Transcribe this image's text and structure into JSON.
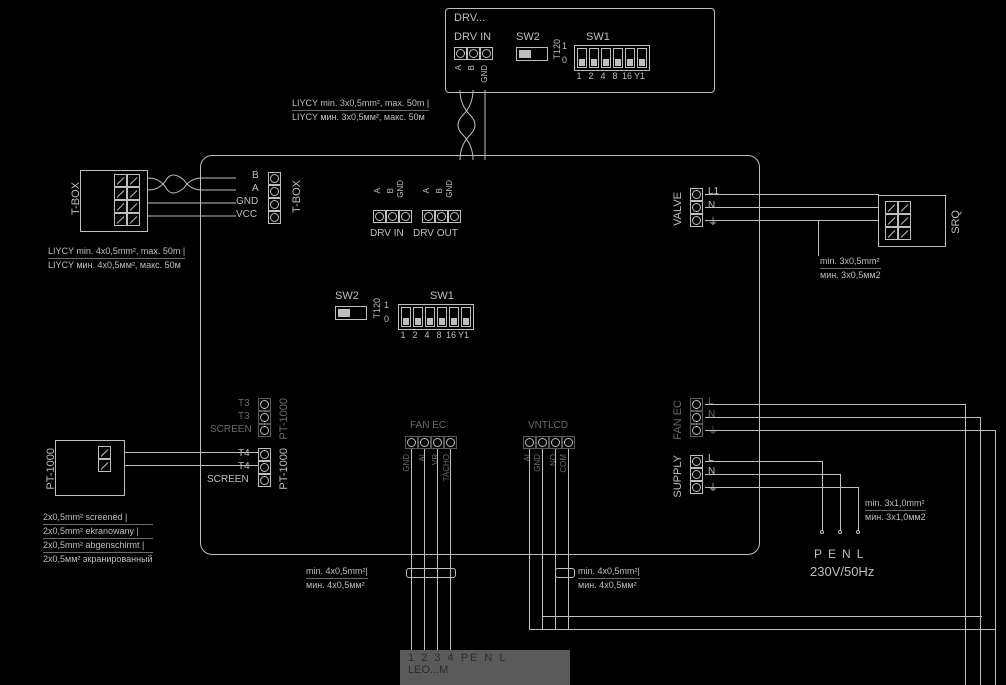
{
  "drv_module": {
    "title": "DRV...",
    "drv_in_label": "DRV IN",
    "sw2_label": "SW2",
    "sw1_label": "SW1",
    "t120_label": "T120",
    "sw1_positions": [
      "1",
      "2",
      "4",
      "8",
      "16",
      "Y1"
    ],
    "sw2_scale": [
      "1",
      "0"
    ],
    "drv_in_pins": [
      "A",
      "B",
      "GND"
    ]
  },
  "cable_notes": {
    "liycy3": {
      "en": "LIYCY min. 3x0,5mm², max. 50m |",
      "ru": "LIYCY мин. 3x0,5мм², макс. 50м"
    },
    "liycy4": {
      "en": "LIYCY min. 4x0,5mm², max. 50m |",
      "ru": "LIYCY мин. 4x0,5мм², макс. 50м"
    },
    "screened": {
      "l1": "2x0,5mm² screened |",
      "l2": "2x0,5mm² ekranowany |",
      "l3": "2x0,5mm² abgenschirmt |",
      "l4": "2x0,5мм² экранированный"
    },
    "min3x05": {
      "en": "min. 3x0,5mm²",
      "ru": "мин. 3x0,5мм2"
    },
    "min4x05": {
      "en": "min. 4x0,5mm²|",
      "ru": "мин. 4x0,5мм²"
    },
    "min3x10": {
      "en": "min. 3x1,0mm²",
      "ru": "мин. 3x1,0мм2"
    }
  },
  "controller": {
    "tbox_left_label": "T-BOX",
    "tbox_conn_label": "T-BOX",
    "tbox_pins": [
      "B",
      "A",
      "GND",
      "VCC"
    ],
    "drv_in_label": "DRV IN",
    "drv_out_label": "DRV OUT",
    "drv_pins": [
      "A",
      "B",
      "GND"
    ],
    "sw2_label": "SW2",
    "sw1_label": "SW1",
    "t120_label": "T120",
    "sw1_positions": [
      "1",
      "2",
      "4",
      "8",
      "16",
      "Y1"
    ],
    "sw2_scale": [
      "1",
      "0"
    ],
    "pt1000_gray_label": "PT-1000",
    "pt1000_gray_pins": [
      "T3",
      "T3",
      "SCREEN"
    ],
    "pt1000_label": "PT-1000",
    "pt1000_pins": [
      "T4",
      "T4",
      "SCREEN"
    ],
    "fan_ec_label": "FAN EC",
    "fan_ec_pins": [
      "GND",
      "AI",
      "VR",
      "TACHO"
    ],
    "vntlcd_label": "VNTLCD",
    "vntlcd_pins": [
      "AI",
      "GND",
      "NO",
      "COM"
    ],
    "valve_label": "VALVE",
    "valve_pins": [
      "L1",
      "N",
      "⏚"
    ],
    "fan_ec_r_label": "FAN EC",
    "fan_ec_r_pins": [
      "L",
      "N",
      "⏚"
    ],
    "supply_label": "SUPPLY",
    "supply_pins": [
      "L",
      "N",
      "⏚"
    ]
  },
  "external": {
    "pt1000_box_label": "PT-1000",
    "srq_label": "SRQ"
  },
  "mains": {
    "pe": "PE",
    "n": "N",
    "l": "L",
    "spec": "230V/50Hz"
  },
  "bottom_strip": {
    "pins": "1  2  3  4 PE N L",
    "model": "LEO...M"
  }
}
